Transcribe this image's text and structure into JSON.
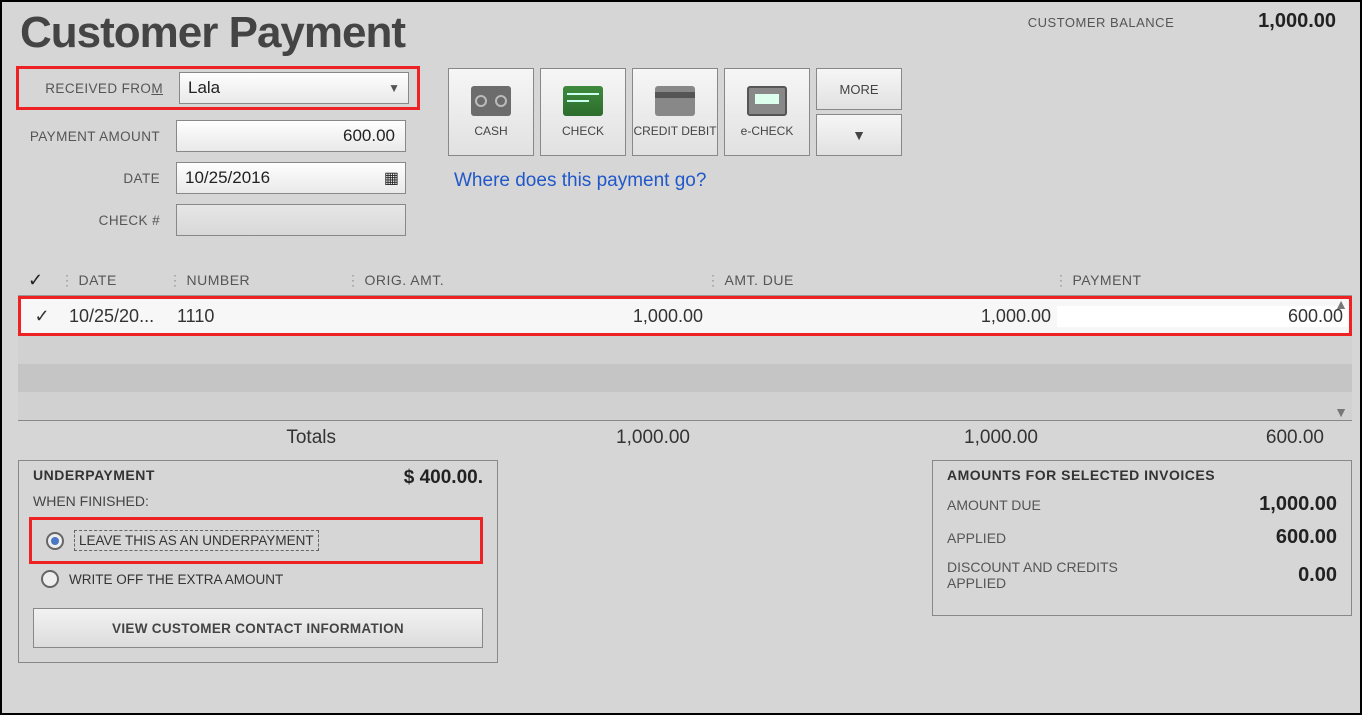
{
  "title": "Customer Payment",
  "balance": {
    "label": "CUSTOMER BALANCE",
    "value": "1,000.00"
  },
  "fields": {
    "received_label_pre": "RECEIVED FRO",
    "received_label_m": "M",
    "received_value": "Lala",
    "amount_label": "PAYMENT AMOUNT",
    "amount_value": "600.00",
    "date_label": "DATE",
    "date_value": "10/25/2016",
    "check_label": "CHECK #",
    "check_value": ""
  },
  "methods": {
    "cash": "CASH",
    "check": "CHECK",
    "card": "CREDIT DEBIT",
    "echeck": "e-CHECK",
    "more": "MORE"
  },
  "link": "Where does this payment go?",
  "table": {
    "headers": {
      "date": "DATE",
      "number": "NUMBER",
      "orig": "ORIG. AMT.",
      "due": "AMT. DUE",
      "pay": "PAYMENT"
    },
    "row": {
      "date": "10/25/20...",
      "number": "1110",
      "orig": "1,000.00",
      "due": "1,000.00",
      "pay": "600.00"
    },
    "totals": {
      "label": "Totals",
      "orig": "1,000.00",
      "due": "1,000.00",
      "pay": "600.00"
    }
  },
  "underpayment": {
    "title": "UNDERPAYMENT",
    "amount": "$ 400.00.",
    "when": "WHEN FINISHED:",
    "opt1": "LEAVE THIS AS AN UNDERPAYMENT",
    "opt2": "WRITE OFF THE EXTRA AMOUNT",
    "button": "VIEW CUSTOMER CONTACT INFORMATION"
  },
  "summary": {
    "title": "AMOUNTS FOR SELECTED INVOICES",
    "rows": [
      {
        "label": "AMOUNT DUE",
        "value": "1,000.00"
      },
      {
        "label": "APPLIED",
        "value": "600.00"
      },
      {
        "label": "DISCOUNT AND CREDITS APPLIED",
        "value": "0.00"
      }
    ]
  }
}
